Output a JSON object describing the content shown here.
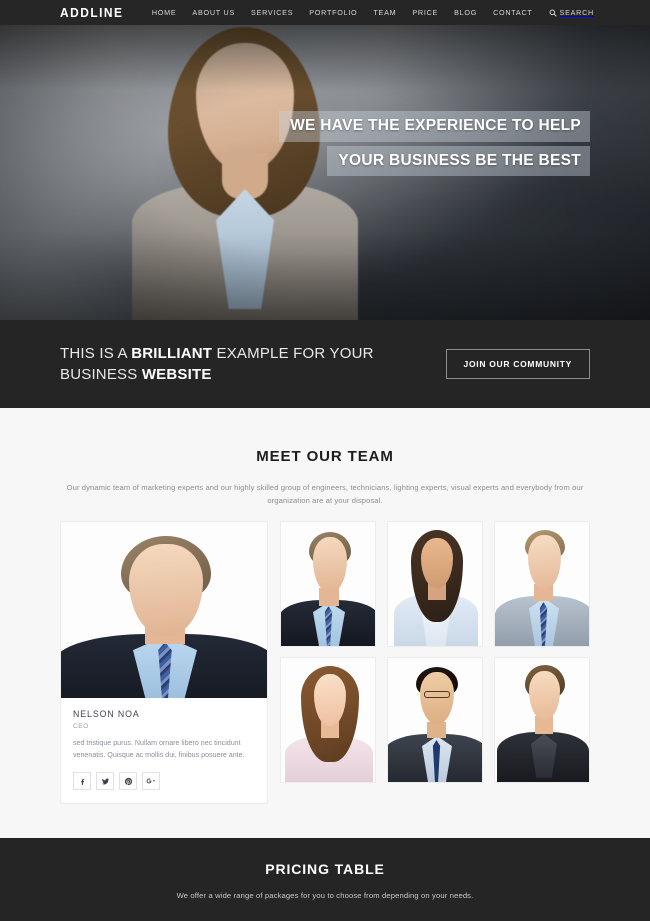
{
  "header": {
    "logo": "ADDLINE",
    "nav": [
      {
        "label": "HOME"
      },
      {
        "label": "ABOUT US"
      },
      {
        "label": "SERVICES"
      },
      {
        "label": "PORTFOLIO"
      },
      {
        "label": "TEAM"
      },
      {
        "label": "PRICE"
      },
      {
        "label": "BLOG"
      },
      {
        "label": "CONTACT"
      }
    ],
    "search_label": "SEARCH",
    "search_icon": "search-icon",
    "background": "#262626"
  },
  "hero": {
    "line1": "WE HAVE THE EXPERIENCE TO HELP",
    "line2": "YOUR BUSINESS BE THE BEST"
  },
  "cta": {
    "text_part1": "THIS IS A ",
    "text_bold1": "BRILLIANT",
    "text_part2": " EXAMPLE FOR YOUR BUSINESS ",
    "text_bold2": "WEBSITE",
    "button_label": "JOIN OUR COMMUNITY",
    "background": "#252525"
  },
  "team": {
    "title": "MEET OUR TEAM",
    "subtitle": "Our dynamic team of marketing experts and our highly skilled group of engineers, technicians, lighting experts, visual experts and everybody from our organization are at your disposal.",
    "featured": {
      "name": "NELSON NOA",
      "role": "CEO",
      "description": "sed tristique purus. Nullam ornare libero nec tincidunt venenatis. Quisque ac mollis dui, finibus posuere ante.",
      "social": [
        {
          "name": "facebook-icon",
          "glyph": "f"
        },
        {
          "name": "twitter-icon",
          "glyph": "t"
        },
        {
          "name": "pinterest-icon",
          "glyph": "p"
        },
        {
          "name": "google-plus-icon",
          "glyph": "g"
        }
      ]
    },
    "thumbnails": [
      {
        "alt": "team-member-man-dark-suit"
      },
      {
        "alt": "team-member-woman-white-blazer"
      },
      {
        "alt": "team-member-man-grey-suit"
      },
      {
        "alt": "team-member-woman-pink-shirt"
      },
      {
        "alt": "team-member-man-glasses"
      },
      {
        "alt": "team-member-woman-black-suit"
      }
    ]
  },
  "pricing": {
    "title": "PRICING TABLE",
    "subtitle": "We offer a wide range of packages for you to choose from depending on your needs.",
    "background": "#252525"
  }
}
